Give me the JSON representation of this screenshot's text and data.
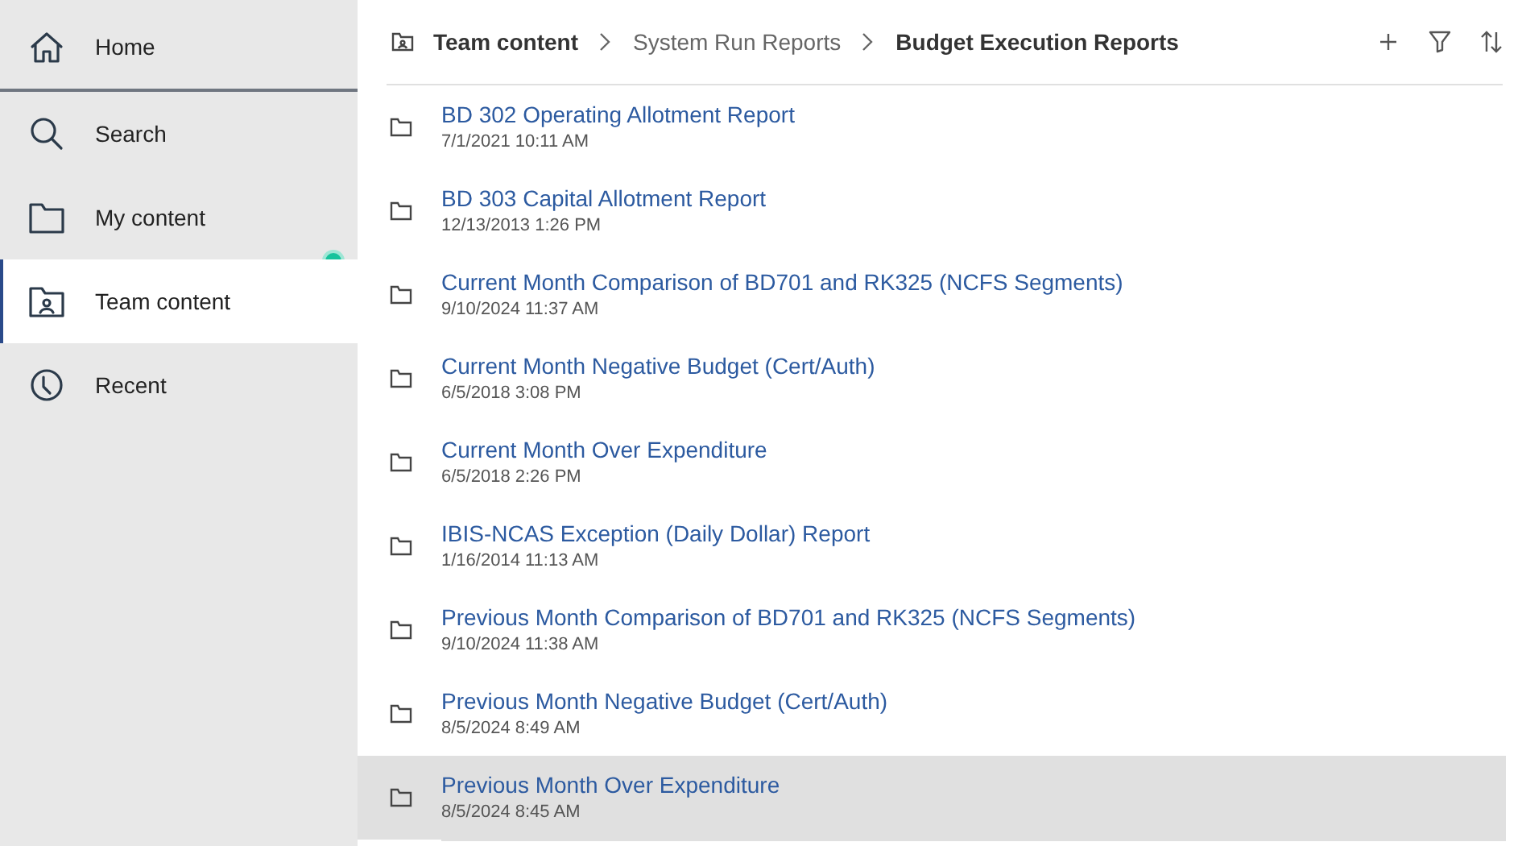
{
  "sidebar": {
    "items": [
      {
        "kind": "home",
        "label": "Home",
        "selected": false
      },
      {
        "kind": "search",
        "label": "Search",
        "selected": false
      },
      {
        "kind": "folder",
        "label": "My content",
        "selected": false
      },
      {
        "kind": "team",
        "label": "Team content",
        "selected": true
      },
      {
        "kind": "recent",
        "label": "Recent",
        "selected": false
      }
    ]
  },
  "breadcrumb": [
    {
      "label": "Team content",
      "bold": true
    },
    {
      "label": "System Run Reports",
      "bold": false
    },
    {
      "label": "Budget Execution Reports",
      "bold": true
    }
  ],
  "rows": [
    {
      "name": "BD 302 Operating Allotment Report",
      "modified": "7/1/2021 10:11 AM",
      "selected": false
    },
    {
      "name": "BD 303 Capital Allotment Report",
      "modified": "12/13/2013 1:26 PM",
      "selected": false
    },
    {
      "name": "Current Month Comparison of BD701 and RK325 (NCFS Segments)",
      "modified": "9/10/2024 11:37 AM",
      "selected": false
    },
    {
      "name": "Current Month Negative Budget (Cert/Auth)",
      "modified": "6/5/2018 3:08 PM",
      "selected": false
    },
    {
      "name": "Current Month Over Expenditure",
      "modified": "6/5/2018 2:26 PM",
      "selected": false
    },
    {
      "name": "IBIS-NCAS Exception (Daily Dollar) Report",
      "modified": "1/16/2014 11:13 AM",
      "selected": false
    },
    {
      "name": "Previous Month Comparison of BD701 and RK325 (NCFS Segments)",
      "modified": "9/10/2024 11:38 AM",
      "selected": false
    },
    {
      "name": "Previous Month Negative Budget (Cert/Auth)",
      "modified": "8/5/2024 8:49 AM",
      "selected": false
    },
    {
      "name": "Previous Month Over Expenditure",
      "modified": "8/5/2024 8:45 AM",
      "selected": true
    }
  ]
}
